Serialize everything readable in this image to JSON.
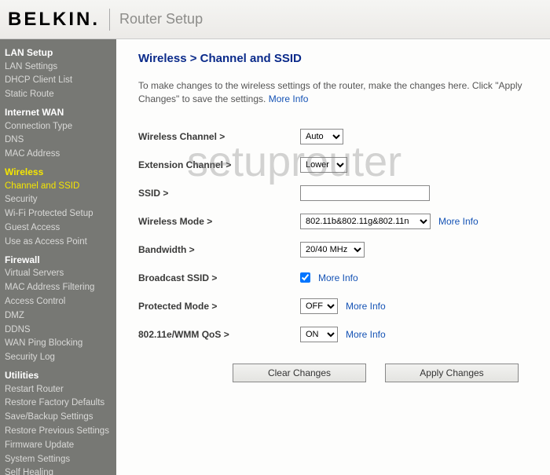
{
  "header": {
    "logo": "BELKIN",
    "page_title": "Router Setup"
  },
  "sidebar": {
    "sections": [
      {
        "head": "LAN Setup",
        "items": [
          "LAN Settings",
          "DHCP Client List",
          "Static Route"
        ]
      },
      {
        "head": "Internet WAN",
        "items": [
          "Connection Type",
          "DNS",
          "MAC Address"
        ]
      },
      {
        "head": "Wireless",
        "head_active": true,
        "items": [
          "Channel and SSID",
          "Security",
          "Wi-Fi Protected Setup",
          "Guest Access",
          "Use as Access Point"
        ],
        "active_item": "Channel and SSID"
      },
      {
        "head": "Firewall",
        "items": [
          "Virtual Servers",
          "MAC Address Filtering",
          "Access Control",
          "DMZ",
          "DDNS",
          "WAN Ping Blocking",
          "Security Log"
        ]
      },
      {
        "head": "Utilities",
        "items": [
          "Restart Router",
          "Restore Factory Defaults",
          "Save/Backup Settings",
          "Restore Previous Settings",
          "Firmware Update",
          "System Settings",
          "Self Healing"
        ]
      }
    ]
  },
  "main": {
    "breadcrumb": "Wireless > Channel and SSID",
    "intro_text": "To make changes to the wireless settings of the router, make the changes here. Click \"Apply Changes\" to save the settings. ",
    "more_info": "More Info",
    "rows": {
      "wireless_channel": {
        "label": "Wireless Channel >",
        "value": "Auto"
      },
      "extension_channel": {
        "label": "Extension Channel >",
        "value": "Lower"
      },
      "ssid": {
        "label": "SSID >",
        "value": ""
      },
      "wireless_mode": {
        "label": "Wireless Mode >",
        "value": "802.11b&802.11g&802.11n"
      },
      "bandwidth": {
        "label": "Bandwidth >",
        "value": "20/40 MHz"
      },
      "broadcast_ssid": {
        "label": "Broadcast SSID >",
        "checked": true
      },
      "protected_mode": {
        "label": "Protected Mode >",
        "value": "OFF"
      },
      "wmm_qos": {
        "label": "802.11e/WMM QoS >",
        "value": "ON"
      }
    },
    "buttons": {
      "clear": "Clear Changes",
      "apply": "Apply Changes"
    }
  },
  "watermark": "setuprouter"
}
